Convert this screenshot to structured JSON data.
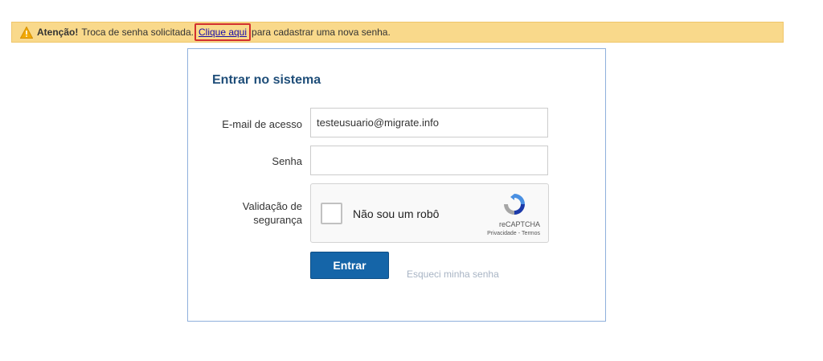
{
  "alert": {
    "icon": "warning-icon",
    "bold_text": "Atenção!",
    "text_before": "Troca de senha solicitada.",
    "link_text": "Clique aqui",
    "text_after": "para cadastrar uma nova senha."
  },
  "login": {
    "title": "Entrar no sistema",
    "email_label": "E-mail de acesso",
    "email_value": "testeusuario@migrate.info",
    "password_label": "Senha",
    "password_value": "",
    "validation_label_line1": "Validação de",
    "validation_label_line2": "segurança",
    "submit_label": "Entrar",
    "forgot_label": "Esqueci minha senha"
  },
  "recaptcha": {
    "label": "Não sou um robô",
    "brand": "reCAPTCHA",
    "privacy": "Privacidade",
    "separator": "-",
    "terms": "Termos"
  },
  "colors": {
    "alert_bg": "#f9d98b",
    "highlight_border": "#d32f2f",
    "card_border": "#8fb0dc",
    "title": "#1f4e79",
    "button": "#1565a8",
    "link": "#1a0dab"
  }
}
